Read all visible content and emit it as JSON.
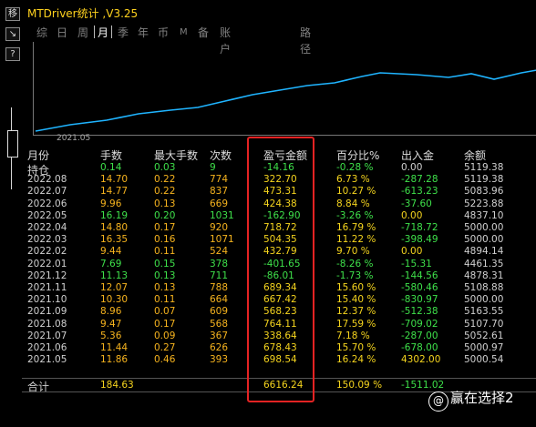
{
  "window": {
    "title": "MTDriver统计 ,V3.25"
  },
  "side_buttons": [
    "移",
    "↘",
    "?"
  ],
  "tabs": [
    {
      "label": "综"
    },
    {
      "label": "日"
    },
    {
      "label": "周"
    },
    {
      "label": "月",
      "active": true
    },
    {
      "label": "季"
    },
    {
      "label": "年"
    },
    {
      "label": "币"
    },
    {
      "label": "M"
    },
    {
      "label": "备"
    },
    {
      "label": "账户"
    },
    {
      "label": "路径"
    }
  ],
  "chart": {
    "x_label": "2021.05",
    "line_color": "#1fb4ff"
  },
  "table": {
    "headers": [
      "月份",
      "手数",
      "最大手数",
      "次数",
      "盈亏金额",
      "百分比%",
      "出入金",
      "余额"
    ],
    "rows": [
      [
        "持仓",
        "0.14",
        "0.03",
        "9",
        "-14.16",
        "-0.28 %",
        "0.00",
        "5119.38"
      ],
      [
        "2022.08",
        "14.70",
        "0.22",
        "774",
        "322.70",
        "6.73 %",
        "-287.28",
        "5119.38"
      ],
      [
        "2022.07",
        "14.77",
        "0.22",
        "837",
        "473.31",
        "10.27 %",
        "-613.23",
        "5083.96"
      ],
      [
        "2022.06",
        "9.96",
        "0.13",
        "669",
        "424.38",
        "8.84 %",
        "-37.60",
        "5223.88"
      ],
      [
        "2022.05",
        "16.19",
        "0.20",
        "1031",
        "-162.90",
        "-3.26 %",
        "0.00",
        "4837.10"
      ],
      [
        "2022.04",
        "14.80",
        "0.17",
        "920",
        "718.72",
        "16.79 %",
        "-718.72",
        "5000.00"
      ],
      [
        "2022.03",
        "16.35",
        "0.16",
        "1071",
        "504.35",
        "11.22 %",
        "-398.49",
        "5000.00"
      ],
      [
        "2022.02",
        "9.44",
        "0.11",
        "524",
        "432.79",
        "9.70 %",
        "0.00",
        "4894.14"
      ],
      [
        "2022.01",
        "7.69",
        "0.15",
        "378",
        "-401.65",
        "-8.26 %",
        "-15.31",
        "4461.35"
      ],
      [
        "2021.12",
        "11.13",
        "0.13",
        "711",
        "-86.01",
        "-1.73 %",
        "-144.56",
        "4878.31"
      ],
      [
        "2021.11",
        "12.07",
        "0.13",
        "788",
        "689.34",
        "15.60 %",
        "-580.46",
        "5108.88"
      ],
      [
        "2021.10",
        "10.30",
        "0.11",
        "664",
        "667.42",
        "15.40 %",
        "-830.97",
        "5000.00"
      ],
      [
        "2021.09",
        "8.96",
        "0.07",
        "609",
        "568.23",
        "12.37 %",
        "-512.38",
        "5163.55"
      ],
      [
        "2021.08",
        "9.47",
        "0.17",
        "568",
        "764.11",
        "17.59 %",
        "-709.02",
        "5107.70"
      ],
      [
        "2021.07",
        "5.36",
        "0.09",
        "367",
        "338.64",
        "7.18 %",
        "-287.00",
        "5052.61"
      ],
      [
        "2021.06",
        "11.44",
        "0.27",
        "626",
        "678.43",
        "15.70 %",
        "-678.00",
        "5000.97"
      ],
      [
        "2021.05",
        "11.86",
        "0.46",
        "393",
        "698.54",
        "16.24 %",
        "4302.00",
        "5000.54"
      ]
    ],
    "total": [
      "合计",
      "184.63",
      "",
      "",
      "6616.24",
      "150.09 %",
      "-1511.02",
      ""
    ]
  },
  "watermark": {
    "badge": "@",
    "text": "赢在选择2"
  }
}
